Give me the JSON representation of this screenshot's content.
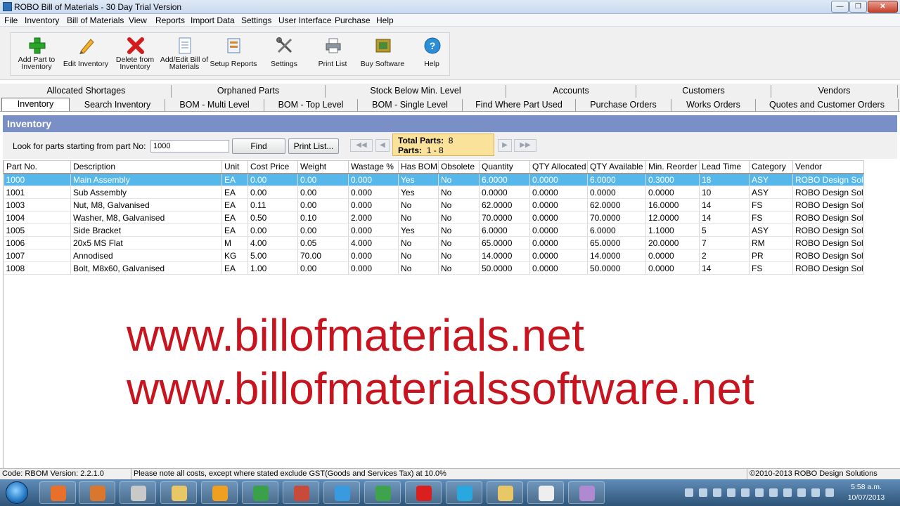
{
  "window": {
    "title": "ROBO Bill of Materials - 30 Day Trial Version"
  },
  "menu": [
    "File",
    "Inventory",
    "Bill of Materials",
    "View",
    "Reports",
    "Import Data",
    "Settings",
    "User Interface",
    "Purchase",
    "Help"
  ],
  "toolbar": [
    {
      "label": "Add Part to Inventory",
      "icon": "add-icon",
      "color": "#2aa52a"
    },
    {
      "label": "Edit Inventory",
      "icon": "pencil-icon",
      "color": "#e59a1b"
    },
    {
      "label": "Delete from Inventory",
      "icon": "delete-icon",
      "color": "#d31c1c"
    },
    {
      "label": "Add/Edit Bill of Materials",
      "icon": "document-icon",
      "color": "#6b8fbf"
    },
    {
      "label": "Setup Reports",
      "icon": "report-icon",
      "color": "#d6872c"
    },
    {
      "label": "Settings",
      "icon": "tools-icon",
      "color": "#555555"
    },
    {
      "label": "Print List",
      "icon": "printer-icon",
      "color": "#6f7a86"
    },
    {
      "label": "Buy Software",
      "icon": "cart-icon",
      "color": "#8a7a1e"
    },
    {
      "label": "Help",
      "icon": "help-icon",
      "color": "#2b8fd8"
    }
  ],
  "tabs_row1": [
    "Allocated Shortages",
    "Orphaned Parts",
    "Stock Below Min. Level",
    "Accounts",
    "Customers",
    "Vendors"
  ],
  "tabs_row2": [
    "Inventory",
    "Search Inventory",
    "BOM - Multi Level",
    "BOM - Top Level",
    "BOM - Single Level",
    "Find Where Part Used",
    "Purchase Orders",
    "Works Orders",
    "Quotes and Customer Orders"
  ],
  "panel": {
    "title": "Inventory",
    "search_label": "Look for parts starting from part No:",
    "search_value": "1000",
    "find_label": "Find",
    "print_label": "Print List...",
    "nav": {
      "first": "◀◀",
      "prev": "◀",
      "next": "▶",
      "last": "▶▶"
    },
    "totals": {
      "total_label": "Total Parts:",
      "total_value": "8",
      "parts_label": "Parts:",
      "parts_value": "1 - 8"
    }
  },
  "grid": {
    "columns": [
      "Part No.",
      "Description",
      "Unit",
      "Cost Price",
      "Weight",
      "Wastage %",
      "Has BOM",
      "Obsolete",
      "Quantity",
      "QTY Allocated",
      "QTY Available",
      "Min. Reorder",
      "Lead Time",
      "Category",
      "Vendor"
    ],
    "rows": [
      [
        "1000",
        "Main Assembly",
        "EA",
        "0.00",
        "0.00",
        "0.000",
        "Yes",
        "No",
        "6.0000",
        "0.0000",
        "6.0000",
        "0.3000",
        "18",
        "ASY",
        "ROBO Design Sol"
      ],
      [
        "1001",
        "Sub Assembly",
        "EA",
        "0.00",
        "0.00",
        "0.000",
        "Yes",
        "No",
        "0.0000",
        "0.0000",
        "0.0000",
        "0.0000",
        "10",
        "ASY",
        "ROBO Design Sol"
      ],
      [
        "1003",
        "Nut, M8, Galvanised",
        "EA",
        "0.11",
        "0.00",
        "0.000",
        "No",
        "No",
        "62.0000",
        "0.0000",
        "62.0000",
        "16.0000",
        "14",
        "FS",
        "ROBO Design Sol"
      ],
      [
        "1004",
        "Washer, M8, Galvanised",
        "EA",
        "0.50",
        "0.10",
        "2.000",
        "No",
        "No",
        "70.0000",
        "0.0000",
        "70.0000",
        "12.0000",
        "14",
        "FS",
        "ROBO Design Sol"
      ],
      [
        "1005",
        "Side Bracket",
        "EA",
        "0.00",
        "0.00",
        "0.000",
        "Yes",
        "No",
        "6.0000",
        "0.0000",
        "6.0000",
        "1.1000",
        "5",
        "ASY",
        "ROBO Design Sol"
      ],
      [
        "1006",
        "20x5 MS Flat",
        "M",
        "4.00",
        "0.05",
        "4.000",
        "No",
        "No",
        "65.0000",
        "0.0000",
        "65.0000",
        "20.0000",
        "7",
        "RM",
        "ROBO Design Sol"
      ],
      [
        "1007",
        "Annodised",
        "KG",
        "5.00",
        "70.00",
        "0.000",
        "No",
        "No",
        "14.0000",
        "0.0000",
        "14.0000",
        "0.0000",
        "2",
        "PR",
        "ROBO Design Sol"
      ],
      [
        "1008",
        "Bolt, M8x60, Galvanised",
        "EA",
        "1.00",
        "0.00",
        "0.000",
        "No",
        "No",
        "50.0000",
        "0.0000",
        "50.0000",
        "0.0000",
        "14",
        "FS",
        "ROBO Design Sol"
      ]
    ]
  },
  "promo": {
    "line1": "www.billofmaterials.net",
    "line2": "www.billofmaterialssoftware.net"
  },
  "status": {
    "left": "Code: RBOM Version: 2.2.1.0",
    "middle": "Please note all costs, except where stated exclude GST(Goods and Services Tax) at 10.0%",
    "right": "©2010-2013 ROBO Design Solutions"
  },
  "taskbar": {
    "apps": [
      {
        "icon": "firefox-icon",
        "color": "#e8702a"
      },
      {
        "icon": "media-player-icon",
        "color": "#d9772f"
      },
      {
        "icon": "notepad-icon",
        "color": "#c9c9c9"
      },
      {
        "icon": "file-explorer-icon",
        "color": "#e8c766"
      },
      {
        "icon": "media-center-icon",
        "color": "#f0a020"
      },
      {
        "icon": "hp-icon",
        "color": "#3aa04a"
      },
      {
        "icon": "printer-app-icon",
        "color": "#c84a3a"
      },
      {
        "icon": "ie-icon",
        "color": "#3a9ae0"
      },
      {
        "icon": "chrome-icon",
        "color": "#3fa34d"
      },
      {
        "icon": "opera-icon",
        "color": "#d9201e"
      },
      {
        "icon": "skype-icon",
        "color": "#29a8e0"
      },
      {
        "icon": "folder-icon",
        "color": "#e8c766"
      },
      {
        "icon": "document-app-icon",
        "color": "#eeeeee"
      },
      {
        "icon": "paint-icon",
        "color": "#b08ad0"
      }
    ],
    "clock_time": "5:58 a.m.",
    "clock_date": "10/07/2013"
  }
}
